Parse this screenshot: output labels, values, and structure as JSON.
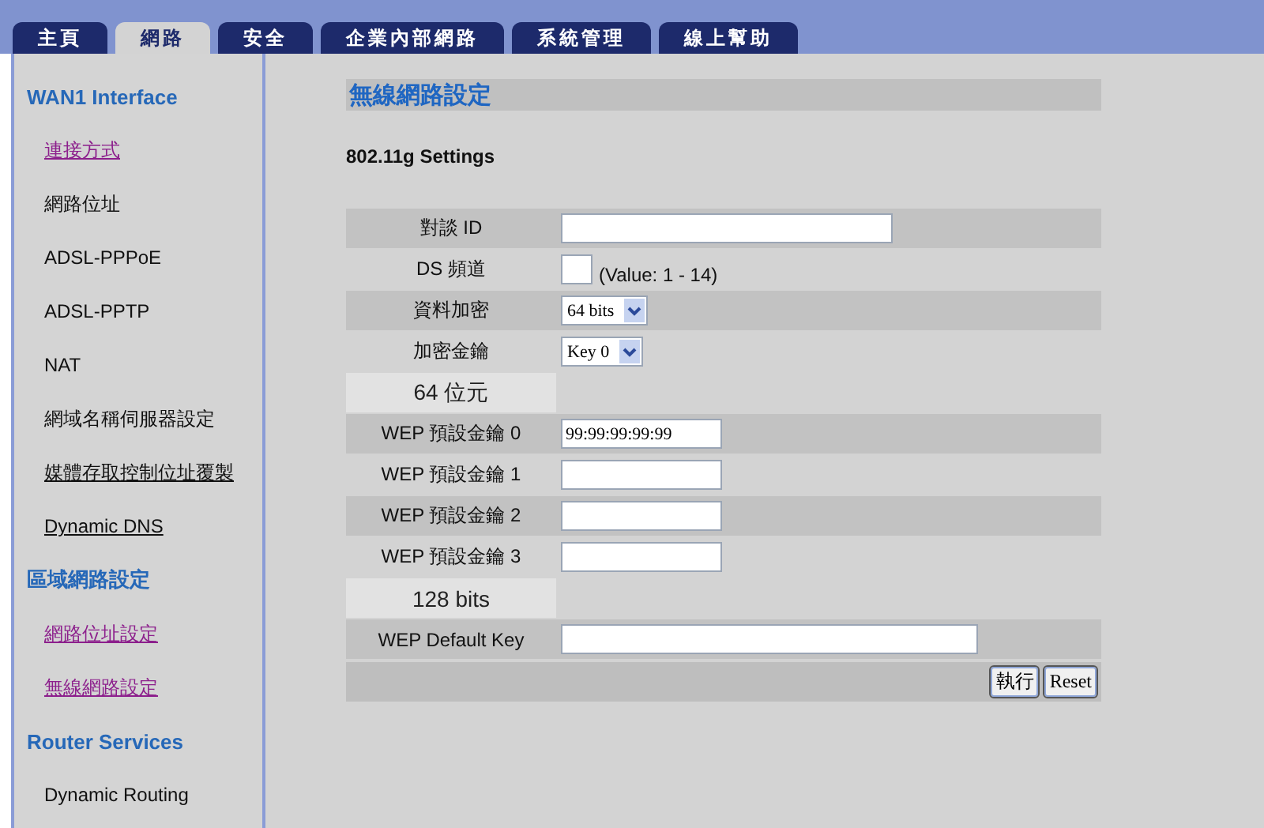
{
  "tabs": [
    {
      "label": "主頁",
      "selected": false
    },
    {
      "label": "網路",
      "selected": true
    },
    {
      "label": "安全",
      "selected": false
    },
    {
      "label": "企業內部網路",
      "selected": false
    },
    {
      "label": "系統管理",
      "selected": false
    },
    {
      "label": "線上幫助",
      "selected": false
    }
  ],
  "sidebar": {
    "items": [
      {
        "kind": "header",
        "label": "WAN1 Interface"
      },
      {
        "kind": "link",
        "label": "連接方式",
        "visited": true,
        "underlined": true
      },
      {
        "kind": "link",
        "label": "網路位址",
        "visited": false,
        "underlined": false
      },
      {
        "kind": "link",
        "label": "ADSL-PPPoE",
        "visited": false,
        "underlined": false
      },
      {
        "kind": "link",
        "label": "ADSL-PPTP",
        "visited": false,
        "underlined": false
      },
      {
        "kind": "link",
        "label": "NAT",
        "visited": false,
        "underlined": false
      },
      {
        "kind": "link",
        "label": "網域名稱伺服器設定",
        "visited": false,
        "underlined": false
      },
      {
        "kind": "link",
        "label": "媒體存取控制位址覆製",
        "visited": false,
        "underlined": true
      },
      {
        "kind": "link",
        "label": "Dynamic DNS",
        "visited": false,
        "underlined": true
      },
      {
        "kind": "header",
        "label": "區域網路設定"
      },
      {
        "kind": "link",
        "label": "網路位址設定",
        "visited": true,
        "underlined": true
      },
      {
        "kind": "link",
        "label": "無線網路設定",
        "visited": true,
        "underlined": true
      },
      {
        "kind": "header",
        "label": "Router Services"
      },
      {
        "kind": "link",
        "label": "Dynamic Routing",
        "visited": false,
        "underlined": false
      }
    ]
  },
  "page": {
    "title": "無線網路設定",
    "subtitle": "802.11g Settings"
  },
  "form": {
    "rows": [
      {
        "kind": "mediumtext",
        "label": "對談 ID"
      },
      {
        "kind": "tinytext",
        "label": "DS 頻道",
        "hint": "(Value: 1 - 14)"
      },
      {
        "kind": "select",
        "label": "資料加密",
        "value": "64 bits"
      },
      {
        "kind": "select",
        "label": "加密金鑰",
        "value": "Key 0"
      },
      {
        "kind": "section",
        "label": "64 位元"
      },
      {
        "kind": "shorttext",
        "label": "WEP 預設金鑰 0",
        "value": "99:99:99:99:99"
      },
      {
        "kind": "shorttext",
        "label": "WEP 預設金鑰 1"
      },
      {
        "kind": "shorttext",
        "label": "WEP 預設金鑰 2"
      },
      {
        "kind": "shorttext",
        "label": "WEP 預設金鑰 3"
      },
      {
        "kind": "section",
        "label": "128 bits"
      },
      {
        "kind": "longtext",
        "label": "WEP Default Key"
      }
    ],
    "buttons": [
      "執行",
      "Reset"
    ]
  }
}
